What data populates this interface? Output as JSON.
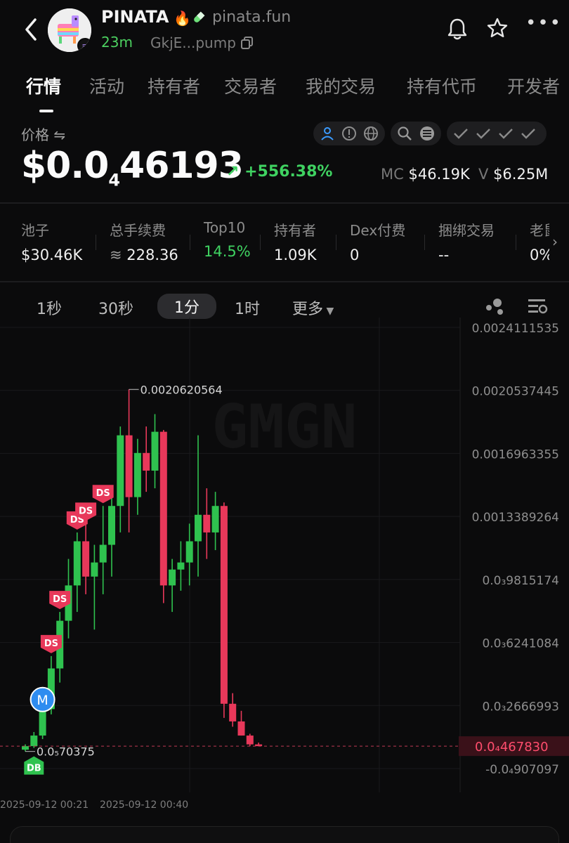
{
  "header": {
    "token_name": "PINATA",
    "site": "pinata.fun",
    "age": "23m",
    "address": "GkjE...pump",
    "icons": [
      "back-chevron-icon",
      "fire-icon",
      "pill-icon",
      "copy-icon",
      "bell-icon",
      "star-icon",
      "more-dots-icon"
    ]
  },
  "tabs": [
    {
      "label": "行情",
      "active": true
    },
    {
      "label": "活动"
    },
    {
      "label": "持有者"
    },
    {
      "label": "交易者"
    },
    {
      "label": "我的交易"
    },
    {
      "label": "持有代币"
    },
    {
      "label": "开发者"
    }
  ],
  "price": {
    "label": "价格 ⇋",
    "prefix": "$0.0",
    "zeros": "4",
    "digits": "46193",
    "change": "↗ +556.38%",
    "mc_label": "MC",
    "mc_value": "$46.19K",
    "vol_label": "V",
    "vol_value": "$6.25M"
  },
  "stats": [
    {
      "label": "池子",
      "value": "$30.46K"
    },
    {
      "label": "总手续费",
      "value": "228.36"
    },
    {
      "label": "Top10",
      "value": "14.5%",
      "green": true
    },
    {
      "label": "持有者",
      "value": "1.09K"
    },
    {
      "label": "Dex付费",
      "value": "0"
    },
    {
      "label": "捆绑交易",
      "value": "--"
    },
    {
      "label": "老鼠仓",
      "value": "0%"
    }
  ],
  "intervals": {
    "items": [
      "1秒",
      "30秒",
      "1分",
      "1时"
    ],
    "active": "1分",
    "more": "更多"
  },
  "colors": {
    "up": "#2fc24f",
    "down": "#e8385a",
    "accent_green": "#3fd261",
    "background": "#0b0b0c",
    "marker_blue": "#2e8cf0"
  },
  "chart_data": {
    "type": "candlestick",
    "watermark": "GMGN",
    "y_axis_labels": [
      "0.0024111535",
      "0.0020537445",
      "0.0016963355",
      "0.0013389264",
      "0.0₃9815174",
      "0.0₃6241084",
      "0.0₃2666993",
      "-0.0₄907097"
    ],
    "last_price_label": "0.0₄467830",
    "x_axis_labels": [
      "2025-09-12 00:21",
      "2025-09-12 00:40"
    ],
    "high_label": "0.0020620564",
    "low_label": "0.0₅70375",
    "ylim": [
      -9.07097e-05,
      0.0024111535
    ],
    "candles": [
      {
        "o": 2e-05,
        "h": 5e-05,
        "l": 1e-05,
        "c": 4e-05
      },
      {
        "o": 4e-05,
        "h": 0.00012,
        "l": 3e-05,
        "c": 0.0001
      },
      {
        "o": 0.0001,
        "h": 0.00028,
        "l": 8e-05,
        "c": 0.00025
      },
      {
        "o": 0.00025,
        "h": 0.00055,
        "l": 0.00022,
        "c": 0.00048
      },
      {
        "o": 0.00048,
        "h": 0.0008,
        "l": 0.0004,
        "c": 0.00075
      },
      {
        "o": 0.00075,
        "h": 0.0011,
        "l": 0.00065,
        "c": 0.00095
      },
      {
        "o": 0.00095,
        "h": 0.00125,
        "l": 0.0008,
        "c": 0.0012
      },
      {
        "o": 0.0012,
        "h": 0.0013,
        "l": 0.0009,
        "c": 0.001
      },
      {
        "o": 0.001,
        "h": 0.00118,
        "l": 0.0007,
        "c": 0.00108
      },
      {
        "o": 0.00108,
        "h": 0.0014,
        "l": 0.0009,
        "c": 0.00118
      },
      {
        "o": 0.00118,
        "h": 0.0015,
        "l": 0.001,
        "c": 0.0014
      },
      {
        "o": 0.0014,
        "h": 0.00185,
        "l": 0.00125,
        "c": 0.0018
      },
      {
        "o": 0.0018,
        "h": 0.00206,
        "l": 0.00125,
        "c": 0.00145
      },
      {
        "o": 0.00145,
        "h": 0.00178,
        "l": 0.00135,
        "c": 0.0017
      },
      {
        "o": 0.0017,
        "h": 0.00185,
        "l": 0.00148,
        "c": 0.0016
      },
      {
        "o": 0.0016,
        "h": 0.00192,
        "l": 0.0015,
        "c": 0.00182
      },
      {
        "o": 0.00182,
        "h": 0.00183,
        "l": 0.00085,
        "c": 0.00095
      },
      {
        "o": 0.00095,
        "h": 0.0011,
        "l": 0.0008,
        "c": 0.00104
      },
      {
        "o": 0.00104,
        "h": 0.0012,
        "l": 0.00092,
        "c": 0.00108
      },
      {
        "o": 0.00108,
        "h": 0.0013,
        "l": 0.00095,
        "c": 0.0012
      },
      {
        "o": 0.0012,
        "h": 0.0018,
        "l": 0.001,
        "c": 0.00135
      },
      {
        "o": 0.00135,
        "h": 0.0015,
        "l": 0.0011,
        "c": 0.00125
      },
      {
        "o": 0.00125,
        "h": 0.00148,
        "l": 0.00115,
        "c": 0.0014
      },
      {
        "o": 0.0014,
        "h": 0.00142,
        "l": 0.0002,
        "c": 0.00028
      },
      {
        "o": 0.00028,
        "h": 0.00034,
        "l": 0.00015,
        "c": 0.00018
      },
      {
        "o": 0.00018,
        "h": 0.00024,
        "l": 0.0001,
        "c": 0.0001
      },
      {
        "o": 0.0001,
        "h": 0.00011,
        "l": 4e-05,
        "c": 5e-05
      },
      {
        "o": 5e-05,
        "h": 6e-05,
        "l": 4e-05,
        "c": 4e-05
      }
    ],
    "markers": [
      {
        "label": "DB",
        "candle": 1,
        "kind": "buy"
      },
      {
        "label": "M",
        "candle": 2,
        "kind": "migrate"
      },
      {
        "label": "DS",
        "candle": 3,
        "kind": "sell"
      },
      {
        "label": "DS",
        "candle": 4,
        "kind": "sell"
      },
      {
        "label": "DS",
        "candle": 6,
        "kind": "sell"
      },
      {
        "label": "DS",
        "candle": 7,
        "kind": "sell"
      },
      {
        "label": "DS",
        "candle": 9,
        "kind": "sell"
      }
    ]
  }
}
